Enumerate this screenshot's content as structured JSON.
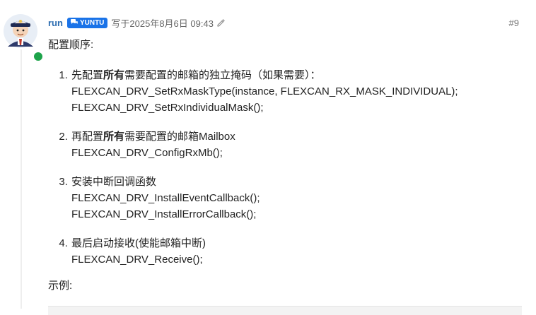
{
  "post": {
    "username": "run",
    "badge": "YUNTU",
    "date": "写于2025年8月6日 09:43",
    "number": "#9",
    "intro": "配置顺序:",
    "steps": [
      {
        "prefix": "先配置",
        "bold": "所有",
        "suffix": "需要配置的邮箱的独立掩码（如果需要）：",
        "code": [
          "FLEXCAN_DRV_SetRxMaskType(instance, FLEXCAN_RX_MASK_INDIVIDUAL);",
          "FLEXCAN_DRV_SetRxIndividualMask();"
        ]
      },
      {
        "prefix": "再配置",
        "bold": "所有",
        "suffix": "需要配置的邮箱Mailbox",
        "code": [
          "FLEXCAN_DRV_ConfigRxMb();"
        ]
      },
      {
        "prefix": "安装中断回调函数",
        "bold": "",
        "suffix": "",
        "code": [
          "FLEXCAN_DRV_InstallEventCallback();",
          "FLEXCAN_DRV_InstallErrorCallback();"
        ]
      },
      {
        "prefix": "最后启动接收(使能邮箱中断)",
        "bold": "",
        "suffix": "",
        "code": [
          "FLEXCAN_DRV_Receive();"
        ]
      }
    ],
    "example_label": "示例:"
  },
  "icons": {
    "avatar": "user-avatar-icon",
    "badge": "chat-bubbles-icon",
    "edit": "pencil-edit-icon",
    "online": "online-status-dot"
  },
  "colors": {
    "username": "#2b6cb0",
    "badge_bg": "#1a73e8",
    "online": "#1da34a"
  }
}
